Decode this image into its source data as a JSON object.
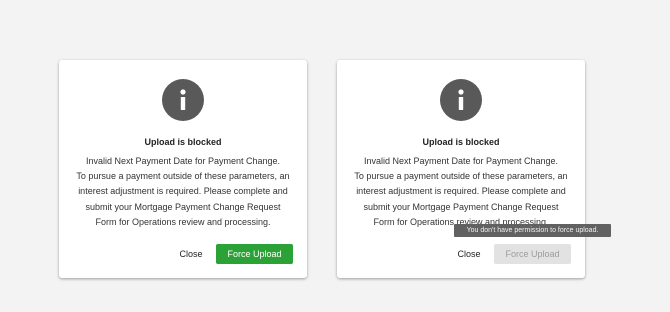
{
  "colors": {
    "background": "#f3f3f3",
    "icon_circle": "#595959",
    "force_upload_enabled": "#2aa236",
    "force_upload_disabled": "#e2e2e2",
    "tooltip_bg": "#616161"
  },
  "dialogs": [
    {
      "icon": "info-icon",
      "title": "Upload is blocked",
      "message_lines": [
        "Invalid Next Payment Date for Payment Change.",
        "To pursue a payment outside of these parameters, an",
        "interest adjustment is required.  Please complete and",
        "submit your Mortgage Payment Change Request",
        "Form for Operations review and processing."
      ],
      "close_label": "Close",
      "force_upload_label": "Force Upload",
      "force_upload_enabled": true
    },
    {
      "icon": "info-icon",
      "title": "Upload is blocked",
      "message_lines": [
        "Invalid Next Payment Date for Payment Change.",
        "To pursue a payment outside of these parameters, an",
        "interest adjustment is required.  Please complete and",
        "submit your Mortgage Payment Change Request",
        "Form for Operations review and processing."
      ],
      "close_label": "Close",
      "force_upload_label": "Force Upload",
      "force_upload_enabled": false
    }
  ],
  "tooltip": {
    "text": "You don't have permission to force upload."
  }
}
